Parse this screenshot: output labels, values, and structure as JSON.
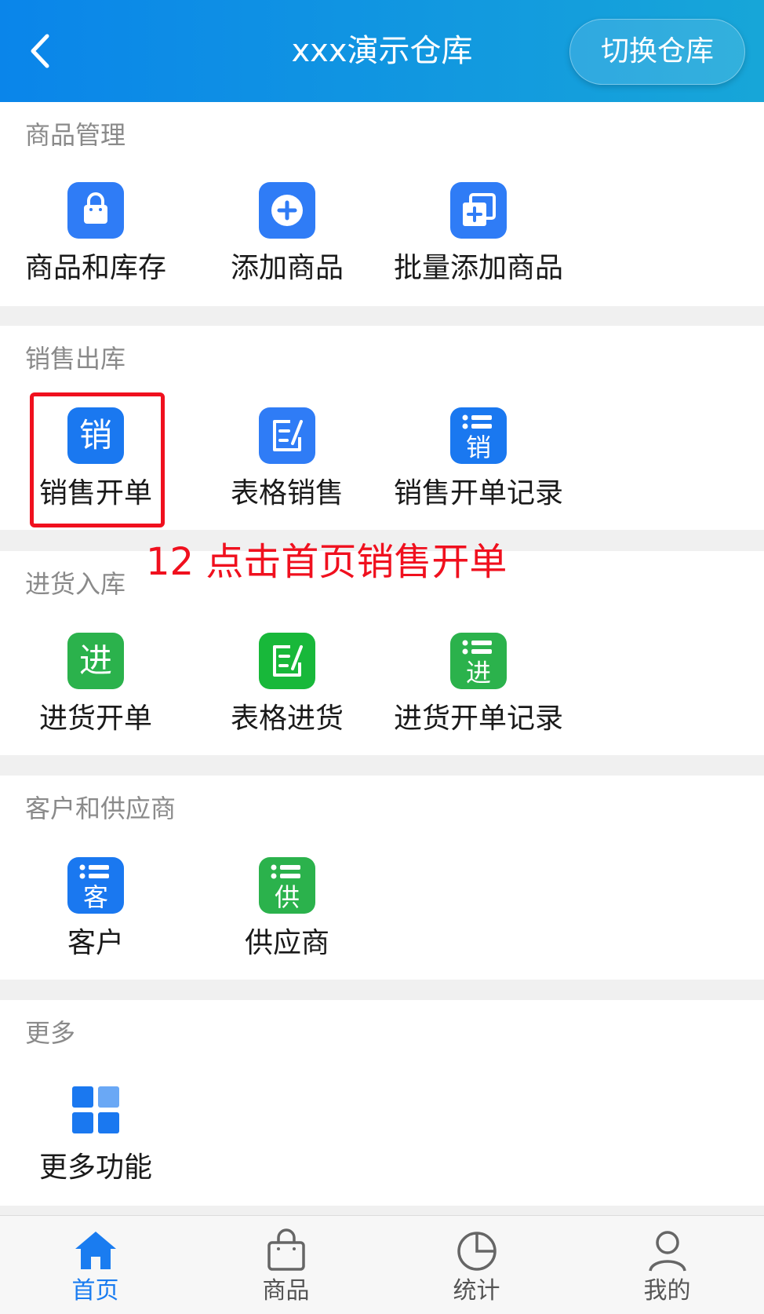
{
  "header": {
    "title": "xxx演示仓库",
    "switch_label": "切换仓库"
  },
  "sections": {
    "goods": {
      "title": "商品管理",
      "items": [
        {
          "label": "商品和库存"
        },
        {
          "label": "添加商品"
        },
        {
          "label": "批量添加商品"
        }
      ]
    },
    "sales": {
      "title": "销售出库",
      "items": [
        {
          "label": "销售开单",
          "glyph": "销"
        },
        {
          "label": "表格销售"
        },
        {
          "label": "销售开单记录",
          "glyph": "销"
        }
      ]
    },
    "purchase": {
      "title": "进货入库",
      "items": [
        {
          "label": "进货开单",
          "glyph": "进"
        },
        {
          "label": "表格进货"
        },
        {
          "label": "进货开单记录",
          "glyph": "进"
        }
      ]
    },
    "partners": {
      "title": "客户和供应商",
      "items": [
        {
          "label": "客户",
          "glyph": "客"
        },
        {
          "label": "供应商",
          "glyph": "供"
        }
      ]
    },
    "more": {
      "title": "更多",
      "items": [
        {
          "label": "更多功能"
        }
      ]
    }
  },
  "annotation": "12 点击首页销售开单",
  "tabs": [
    {
      "label": "首页",
      "icon": "home-icon",
      "active": true
    },
    {
      "label": "商品",
      "icon": "shopping-bag-icon"
    },
    {
      "label": "统计",
      "icon": "pie-chart-icon"
    },
    {
      "label": "我的",
      "icon": "user-icon"
    }
  ],
  "colors": {
    "blue": "#2f7cf6",
    "green": "#2bb24c",
    "accent": "#1a7cf0",
    "annotation": "#f0101e"
  }
}
